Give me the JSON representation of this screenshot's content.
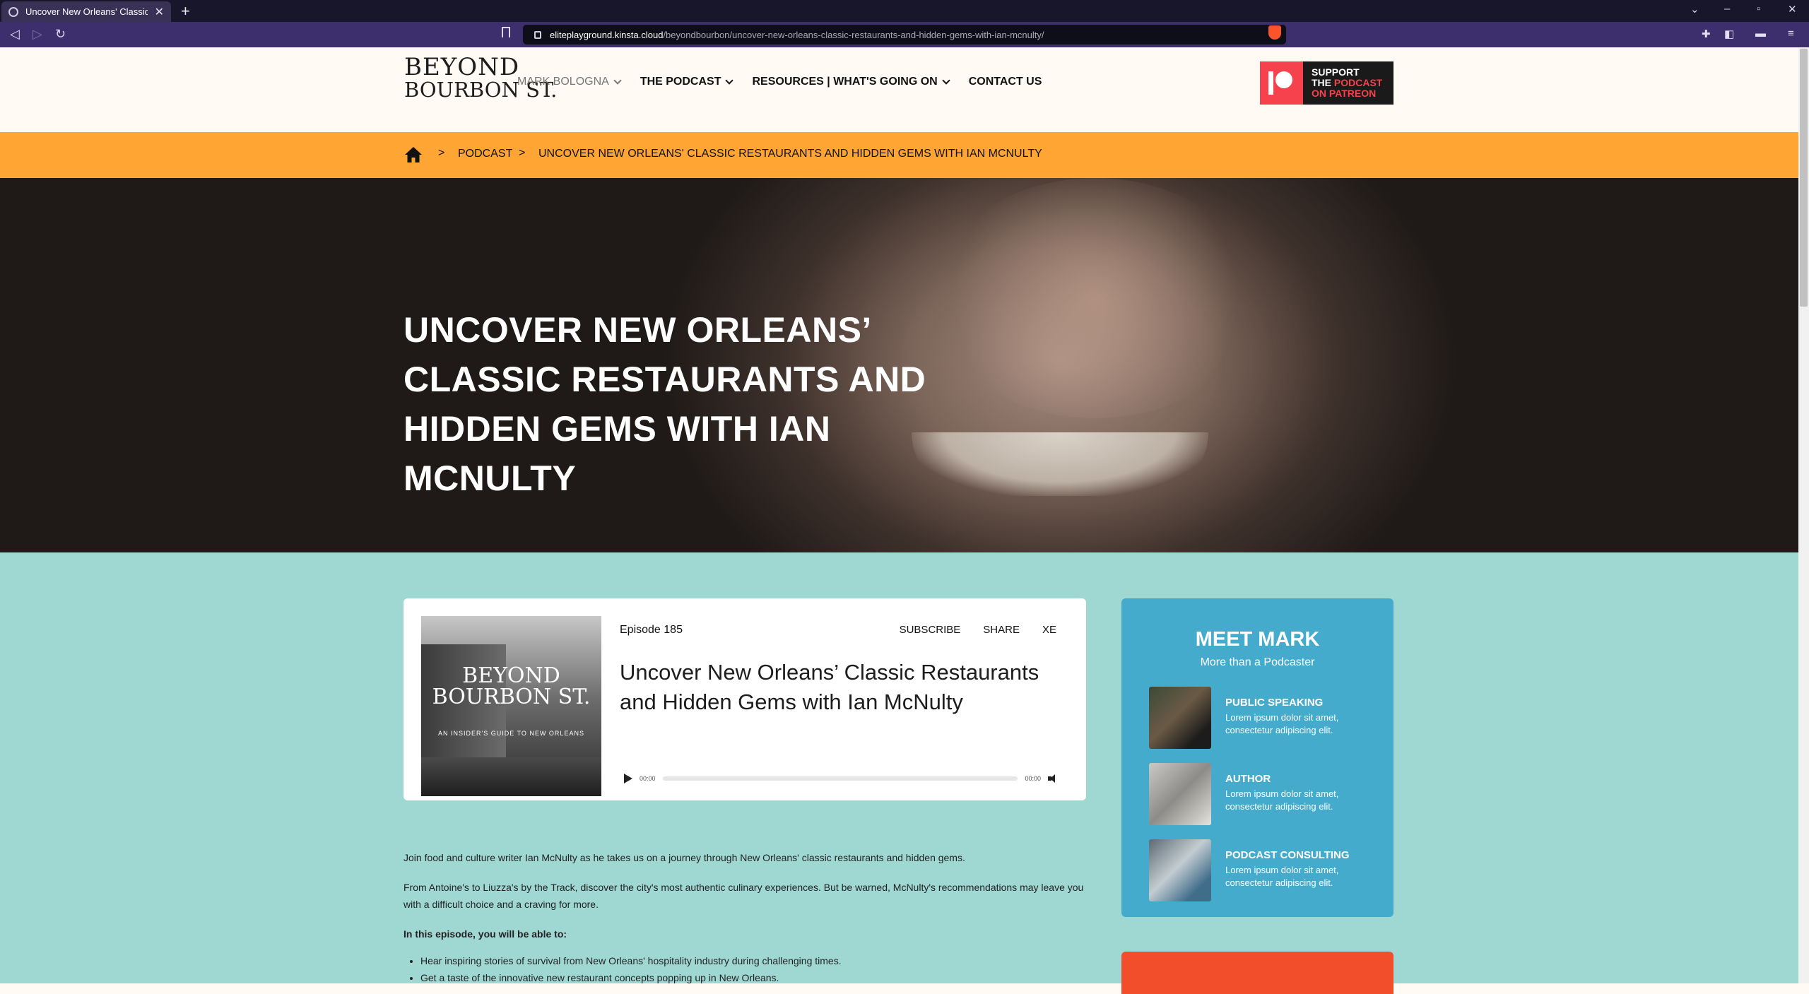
{
  "browser": {
    "tab_title": "Uncover New Orleans' Classic Re",
    "tab_close": "✕",
    "new_tab": "+",
    "url_host": "eliteplayground.kinsta.cloud",
    "url_path": "/beyondbourbon/uncover-new-orleans-classic-restaurants-and-hidden-gems-with-ian-mcnulty/",
    "icons": [
      "back-icon",
      "forward-icon",
      "reload-icon",
      "bookmark-icon",
      "brave-shield-icon",
      "extensions-icon",
      "sidebar-icon",
      "wallet-icon",
      "menu-icon"
    ]
  },
  "header": {
    "logo_line1": "BEYOND",
    "logo_line2": "BOURBON ST.",
    "nav": [
      {
        "label": "MARK BOLOGNA",
        "dropdown": true
      },
      {
        "label": "THE PODCAST",
        "dropdown": true
      },
      {
        "label": "RESOURCES | WHAT'S GOING ON",
        "dropdown": true
      },
      {
        "label": "CONTACT US",
        "dropdown": false
      }
    ],
    "patreon": {
      "line1": "SUPPORT",
      "line2a": "THE ",
      "line2b": "PODCAST",
      "line3": "ON PATREON"
    }
  },
  "breadcrumb": {
    "items": [
      "PODCAST",
      "UNCOVER NEW ORLEANS' CLASSIC RESTAURANTS AND HIDDEN GEMS WITH IAN MCNULTY"
    ],
    "separator": ">"
  },
  "hero": {
    "title": "UNCOVER NEW ORLEANS’ CLASSIC RESTAURANTS AND HIDDEN GEMS WITH IAN MCNULTY"
  },
  "episode": {
    "number": "Episode 185",
    "actions": [
      "SUBSCRIBE",
      "SHARE",
      "XE"
    ],
    "title": "Uncover New Orleans’ Classic Restaurants and Hidden Gems with Ian McNulty",
    "cover_title_1": "BEYOND",
    "cover_title_2": "BOURBON ST.",
    "cover_subtitle": "AN INSIDER'S GUIDE TO NEW ORLEANS",
    "player": {
      "current": "00:00",
      "duration": "00:00",
      "progress": 0
    }
  },
  "description": {
    "p1": "Join food and culture writer Ian McNulty as he takes us on a journey through New Orleans' classic restaurants and hidden gems.",
    "p2": "From Antoine's to Liuzza's by the Track, discover the city's most authentic culinary experiences. But be warned, McNulty's recommendations may leave you with a difficult choice and a craving for more.",
    "lead": "In this episode, you will be able to:",
    "bullets": [
      "Hear inspiring stories of survival from New Orleans' hospitality industry during challenging times.",
      "Get a taste of the innovative new restaurant concepts popping up in New Orleans."
    ]
  },
  "sidebar": {
    "title": "MEET MARK",
    "subtitle": "More than a Podcaster",
    "items": [
      {
        "heading": "PUBLIC SPEAKING",
        "text": "Lorem ipsum dolor sit amet, consectetur adipiscing elit."
      },
      {
        "heading": "AUTHOR",
        "text": "Lorem ipsum dolor sit amet, consectetur adipiscing elit."
      },
      {
        "heading": "PODCAST CONSULTING",
        "text": "Lorem ipsum dolor sit amet, consectetur adipiscing elit."
      }
    ]
  },
  "colors": {
    "breadcrumb_bg": "#ffa534",
    "content_bg": "#9fd8d2",
    "sidebar_card": "#45abcc",
    "patreon_red": "#f5424c",
    "cta_card": "#f24e2c"
  }
}
